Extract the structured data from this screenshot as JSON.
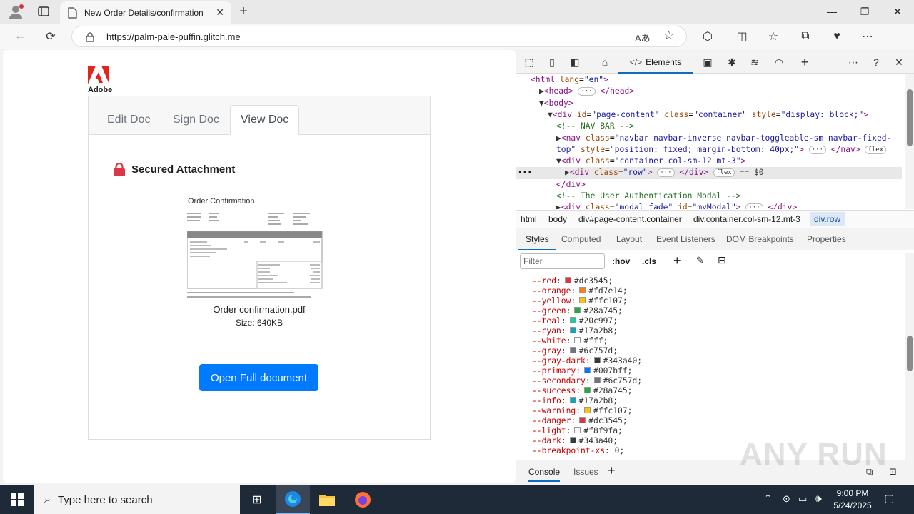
{
  "browser": {
    "tab_title": "New Order Details/confirmation",
    "url": "https://palm-pale-puffin.glitch.me"
  },
  "page": {
    "logo_text": "Adobe",
    "tabs": [
      "Edit Doc",
      "Sign Doc",
      "View Doc"
    ],
    "active_tab": "View Doc",
    "section_title": "Secured Attachment",
    "doc_preview_title": "Order Confirmation",
    "file_name": "Order confirmation.pdf",
    "file_size": "Size: 640KB",
    "open_button": "Open Full document"
  },
  "devtools": {
    "active_tab": "Elements",
    "dom_lines": [
      {
        "indent": 0,
        "html": "<span class=tg>&lt;html</span> <span class=at>lang</span>=<span class=av>\"en\"</span><span class=tg>&gt;</span>"
      },
      {
        "indent": 1,
        "html": "<span class=tx>▶</span><span class=tg>&lt;head&gt;</span> <span class=pill>···</span> <span class=tg>&lt;/head&gt;</span>"
      },
      {
        "indent": 1,
        "html": "<span class=tx>▼</span><span class=tg>&lt;body&gt;</span>"
      },
      {
        "indent": 2,
        "html": "<span class=tx>▼</span><span class=tg>&lt;div</span> <span class=at>id</span>=<span class=av>\"page-content\"</span> <span class=at>class</span>=<span class=av>\"container\"</span> <span class=at>style</span>=<span class=av>\"display: block;\"</span><span class=tg>&gt;</span>"
      },
      {
        "indent": 3,
        "html": "<span class=cm>&lt;!-- NAV BAR --&gt;</span>"
      },
      {
        "indent": 3,
        "html": "<span class=tx>▶</span><span class=tg>&lt;nav</span> <span class=at>class</span>=<span class=av>\"navbar navbar-inverse navbar-toggleable-sm navbar-fixed-</span>"
      },
      {
        "indent": 3,
        "html": "<span class=av>top\"</span> <span class=at>style</span>=<span class=av>\"position: fixed; margin-bottom: 40px;\"</span><span class=tg>&gt;</span> <span class=pill>···</span> <span class=tg>&lt;/nav&gt;</span> <span class=pill>flex</span>"
      },
      {
        "indent": 3,
        "html": "<span class=tx>▼</span><span class=tg>&lt;div</span> <span class=at>class</span>=<span class=av>\"container col-sm-12 mt-3\"</span><span class=tg>&gt;</span>"
      },
      {
        "indent": 4,
        "html": "<span class=tx>▶</span><span class=tg>&lt;div</span> <span class=at>class</span>=<span class=av>\"row\"</span><span class=tg>&gt;</span> <span class=pill>···</span> <span class=tg>&lt;/div&gt;</span> <span class=pill>flex</span> <span class=tx>== $0</span>"
      },
      {
        "indent": 3,
        "html": "<span class=tg>&lt;/div&gt;</span>"
      },
      {
        "indent": 3,
        "html": "<span class=cm>&lt;!-- The User Authentication Modal --&gt;</span>"
      },
      {
        "indent": 3,
        "html": "<span class=tx>▶</span><span class=tg>&lt;div</span> <span class=at>class</span>=<span class=av>\"modal fade\"</span> <span class=at>id</span>=<span class=av>\"myModal\"</span><span class=tg>&gt;</span> <span class=pill>···</span> <span class=tg>&lt;/div&gt;</span>"
      }
    ],
    "breadcrumbs": [
      "html",
      "body",
      "div#page-content.container",
      "div.container.col-sm-12.mt-3",
      "div.row"
    ],
    "styles_tabs": [
      "Styles",
      "Computed",
      "Layout",
      "Event Listeners",
      "DOM Breakpoints",
      "Properties"
    ],
    "filter_placeholder": "Filter",
    "filter_tools": [
      ":hov",
      ".cls"
    ],
    "css_vars": [
      {
        "name": "--red",
        "value": "#dc3545"
      },
      {
        "name": "--orange",
        "value": "#fd7e14"
      },
      {
        "name": "--yellow",
        "value": "#ffc107"
      },
      {
        "name": "--green",
        "value": "#28a745"
      },
      {
        "name": "--teal",
        "value": "#20c997"
      },
      {
        "name": "--cyan",
        "value": "#17a2b8"
      },
      {
        "name": "--white",
        "value": "#fff"
      },
      {
        "name": "--gray",
        "value": "#6c757d"
      },
      {
        "name": "--gray-dark",
        "value": "#343a40"
      },
      {
        "name": "--primary",
        "value": "#007bff"
      },
      {
        "name": "--secondary",
        "value": "#6c757d"
      },
      {
        "name": "--success",
        "value": "#28a745"
      },
      {
        "name": "--info",
        "value": "#17a2b8"
      },
      {
        "name": "--warning",
        "value": "#ffc107"
      },
      {
        "name": "--danger",
        "value": "#dc3545"
      },
      {
        "name": "--light",
        "value": "#f8f9fa"
      },
      {
        "name": "--dark",
        "value": "#343a40"
      },
      {
        "name": "--breakpoint-xs",
        "value": "0"
      }
    ],
    "drawer_tabs": [
      "Console",
      "Issues"
    ]
  },
  "taskbar": {
    "search_placeholder": "Type here to search",
    "time": "9:00 PM",
    "date": "5/24/2025"
  },
  "watermark": "ANY RUN"
}
